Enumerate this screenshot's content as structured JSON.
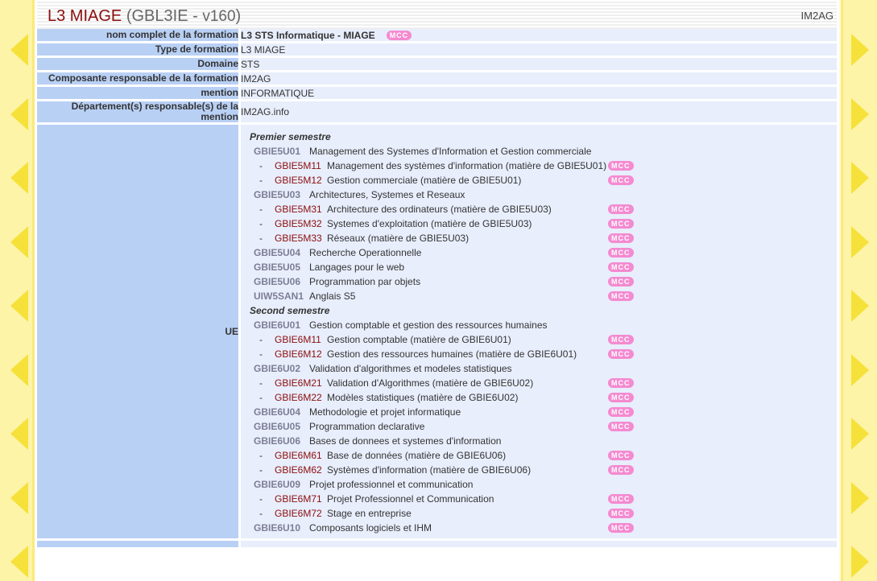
{
  "header": {
    "title_code": "L3 MIAGE",
    "title_paren_open": "(GBL3IE - ",
    "title_version": "v160",
    "title_paren_close": ")",
    "org": "IM2AG"
  },
  "fields": [
    {
      "label": "nom complet de la formation",
      "value": "L3 STS Informatique - MIAGE",
      "bold": true,
      "mcc": true
    },
    {
      "label": "Type de formation",
      "value": "L3 MIAGE"
    },
    {
      "label": "Domaine",
      "value": "STS"
    },
    {
      "label": "Composante responsable de la formation",
      "value": "IM2AG"
    },
    {
      "label": "mention",
      "value": "INFORMATIQUE"
    },
    {
      "label": "Département(s) responsable(s) de la mention",
      "value": "IM2AG.info"
    }
  ],
  "ue_label": "UE",
  "mcc_label": "MCC",
  "semesters": [
    {
      "name": "Premier semestre",
      "items": [
        {
          "kind": "ue",
          "code": "GBIE5U01",
          "label": "Management des Systemes d'Information et Gestion commerciale",
          "mcc": false
        },
        {
          "kind": "mat",
          "code": "GBIE5M11",
          "label": "Management des systèmes d'information (matière de GBIE5U01)",
          "mcc": true
        },
        {
          "kind": "mat",
          "code": "GBIE5M12",
          "label": "Gestion commerciale (matière de GBIE5U01)",
          "mcc": true
        },
        {
          "kind": "ue",
          "code": "GBIE5U03",
          "label": "Architectures, Systemes et Reseaux",
          "mcc": false
        },
        {
          "kind": "mat",
          "code": "GBIE5M31",
          "label": "Architecture des ordinateurs (matière de GBIE5U03)",
          "mcc": true
        },
        {
          "kind": "mat",
          "code": "GBIE5M32",
          "label": "Systemes d'exploitation (matière de GBIE5U03)",
          "mcc": true
        },
        {
          "kind": "mat",
          "code": "GBIE5M33",
          "label": "Réseaux (matière de GBIE5U03)",
          "mcc": true
        },
        {
          "kind": "ue",
          "code": "GBIE5U04",
          "label": "Recherche Operationnelle",
          "mcc": true
        },
        {
          "kind": "ue",
          "code": "GBIE5U05",
          "label": "Langages pour le web",
          "mcc": true
        },
        {
          "kind": "ue",
          "code": "GBIE5U06",
          "label": "Programmation par objets",
          "mcc": true
        },
        {
          "kind": "ue",
          "code": "UIW5SAN1",
          "label": "Anglais S5",
          "mcc": true
        }
      ]
    },
    {
      "name": "Second semestre",
      "items": [
        {
          "kind": "ue",
          "code": "GBIE6U01",
          "label": "Gestion comptable et gestion des ressources humaines",
          "mcc": false
        },
        {
          "kind": "mat",
          "code": "GBIE6M11",
          "label": "Gestion comptable (matière de GBIE6U01)",
          "mcc": true
        },
        {
          "kind": "mat",
          "code": "GBIE6M12",
          "label": "Gestion des ressources humaines (matière de GBIE6U01)",
          "mcc": true
        },
        {
          "kind": "ue",
          "code": "GBIE6U02",
          "label": "Validation d'algorithmes et modeles statistiques",
          "mcc": false
        },
        {
          "kind": "mat",
          "code": "GBIE6M21",
          "label": "Validation d'Algorithmes (matière de GBIE6U02)",
          "mcc": true
        },
        {
          "kind": "mat",
          "code": "GBIE6M22",
          "label": "Modèles statistiques (matière de GBIE6U02)",
          "mcc": true
        },
        {
          "kind": "ue",
          "code": "GBIE6U04",
          "label": "Methodologie et  projet informatique",
          "mcc": true
        },
        {
          "kind": "ue",
          "code": "GBIE6U05",
          "label": "Programmation declarative",
          "mcc": true
        },
        {
          "kind": "ue",
          "code": "GBIE6U06",
          "label": "Bases de donnees et systemes d'information",
          "mcc": false
        },
        {
          "kind": "mat",
          "code": "GBIE6M61",
          "label": "Base de données (matière de GBIE6U06)",
          "mcc": true
        },
        {
          "kind": "mat",
          "code": "GBIE6M62",
          "label": "Systèmes d'information (matière de GBIE6U06)",
          "mcc": true
        },
        {
          "kind": "ue",
          "code": "GBIE6U09",
          "label": "Projet professionnel et communication",
          "mcc": false
        },
        {
          "kind": "mat",
          "code": "GBIE6M71",
          "label": "Projet Professionnel et Communication",
          "mcc": true
        },
        {
          "kind": "mat",
          "code": "GBIE6M72",
          "label": "Stage en entreprise",
          "mcc": true
        },
        {
          "kind": "ue",
          "code": "GBIE6U10",
          "label": "Composants logiciels et IHM",
          "mcc": true
        }
      ]
    }
  ],
  "nav": {
    "left_arrow_count": 9,
    "right_arrow_count": 9
  }
}
